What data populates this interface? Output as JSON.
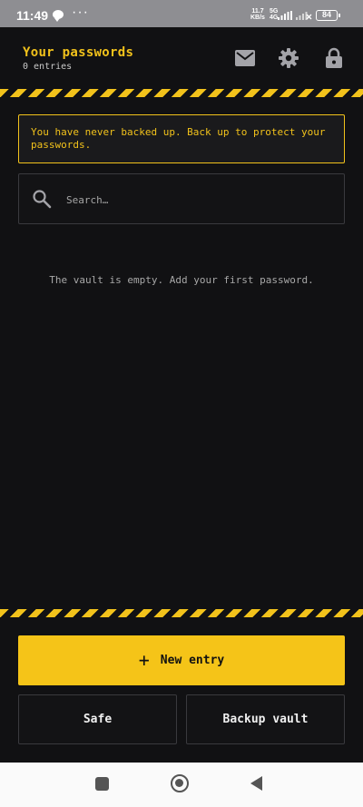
{
  "status_bar": {
    "time": "11:49",
    "more": "···",
    "speed_value": "11.7",
    "speed_unit": "KB/s",
    "network_top": "5G",
    "network_bottom": "4G",
    "battery": "84"
  },
  "header": {
    "title": "Your passwords",
    "subtitle": "0 entries",
    "icons": [
      "mail-icon",
      "settings-icon",
      "lock-icon"
    ]
  },
  "notice": {
    "text": "You have never backed up. Back up to protect your passwords."
  },
  "search": {
    "placeholder": "Search…",
    "value": ""
  },
  "empty_state": {
    "text": "The vault is empty. Add your first password."
  },
  "actions": {
    "new_entry_icon": "+",
    "new_entry_label": "New entry",
    "safe_label": "Safe",
    "backup_label": "Backup vault"
  },
  "colors": {
    "accent": "#f5c418",
    "background": "#111113",
    "border": "#3a3a3e"
  }
}
